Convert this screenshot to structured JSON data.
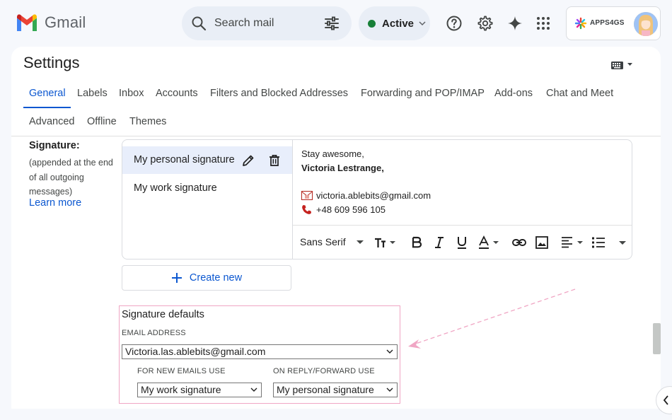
{
  "app": {
    "name": "Gmail",
    "search_placeholder": "Search mail",
    "status_label": "Active",
    "brand": "APPS4GS"
  },
  "settings": {
    "title": "Settings",
    "tabs_row1": [
      {
        "label": "General",
        "active": true
      },
      {
        "label": "Labels"
      },
      {
        "label": "Inbox"
      },
      {
        "label": "Accounts"
      },
      {
        "label": "Filters and Blocked Addresses"
      },
      {
        "label": "Forwarding and POP/IMAP"
      },
      {
        "label": "Add-ons"
      },
      {
        "label": "Chat and Meet"
      }
    ],
    "tabs_row2": [
      {
        "label": "Advanced"
      },
      {
        "label": "Offline"
      },
      {
        "label": "Themes"
      }
    ]
  },
  "signature": {
    "heading": "Signature:",
    "description": "(appended at the end of all outgoing messages)",
    "learn_more": "Learn more",
    "items": [
      {
        "label": "My personal signature",
        "selected": true
      },
      {
        "label": "My work signature"
      }
    ],
    "content": {
      "line1": "Stay awesome,",
      "line2": "Victoria Lestrange,",
      "email": "victoria.ablebits@gmail.com",
      "phone": "+48 609 596 105"
    },
    "toolbar": {
      "font": "Sans Serif"
    },
    "create_new": "Create new"
  },
  "defaults": {
    "title": "Signature defaults",
    "email_label": "EMAIL ADDRESS",
    "email_value": "Victoria.las.ablebits@gmail.com",
    "new_label": "FOR NEW EMAILS USE",
    "new_value": "My work signature",
    "reply_label": "ON REPLY/FORWARD USE",
    "reply_value": "My personal signature"
  },
  "colors": {
    "accent": "#0b57d0",
    "status_green": "#188038",
    "highlight_border": "#f0a6c4"
  }
}
